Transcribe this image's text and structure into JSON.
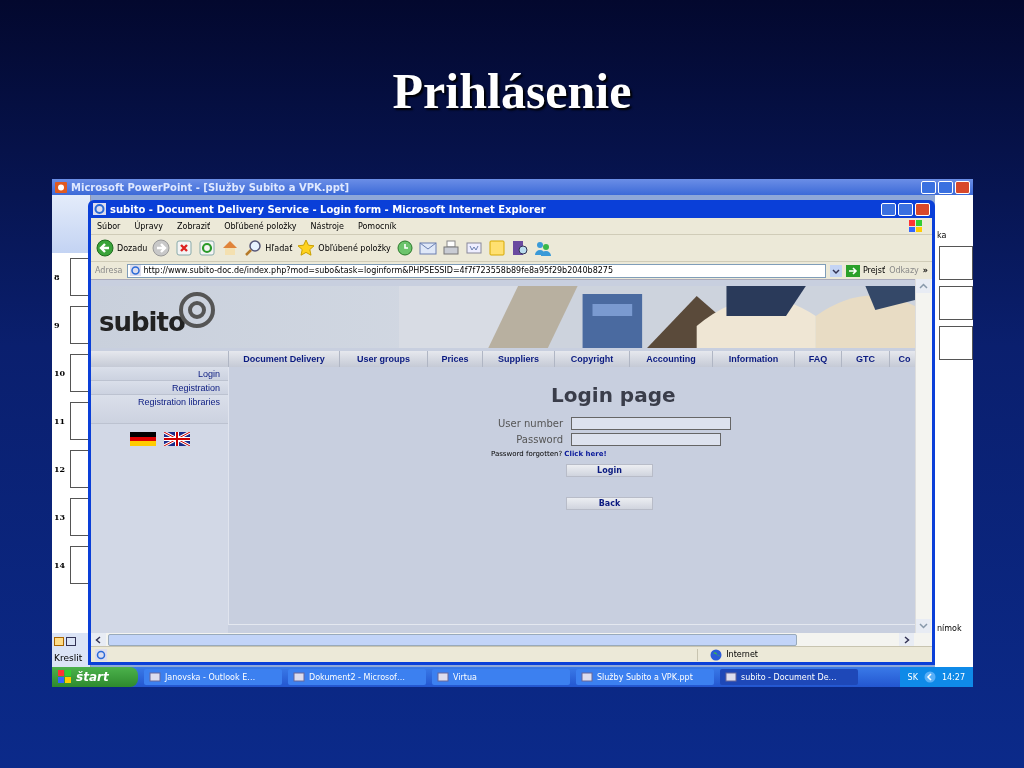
{
  "slide_title": "Prihlásenie",
  "powerpoint": {
    "title": "Microsoft PowerPoint - [Služby Subito a VPK.ppt]",
    "slide_numbers": [
      "8",
      "9",
      "10",
      "11",
      "12",
      "13",
      "14"
    ],
    "right_pane_texts": [
      "ka",
      "nímok"
    ],
    "drawing_toolbar": "Kreslit"
  },
  "browser": {
    "title": "subito - Document Delivery Service - Login form - Microsoft Internet Explorer",
    "menu": [
      "Súbor",
      "Úpravy",
      "Zobraziť",
      "Obľúbené položky",
      "Nástroje",
      "Pomocník"
    ],
    "toolbar": [
      {
        "kind": "back",
        "label": "Dozadu"
      },
      {
        "kind": "forward"
      },
      {
        "kind": "stop"
      },
      {
        "kind": "refresh"
      },
      {
        "kind": "home"
      },
      {
        "kind": "search",
        "label": "Hľadať"
      },
      {
        "kind": "favorites",
        "label": "Obľúbené položky"
      },
      {
        "kind": "history"
      },
      {
        "kind": "mail"
      },
      {
        "kind": "print"
      },
      {
        "kind": "edit"
      },
      {
        "kind": "note"
      },
      {
        "kind": "research"
      },
      {
        "kind": "messenger"
      }
    ],
    "address": {
      "label": "Adresa",
      "url": "http://www.subito-doc.de/index.php?mod=subo&task=loginform&PHPSESSID=4f7f723558b89fe8a95f29b2040b8275",
      "go": "Prejsť",
      "links": "Odkazy",
      "more": "»"
    },
    "page": {
      "logo": "subito",
      "nav": [
        "Document Delivery",
        "User groups",
        "Prices",
        "Suppliers",
        "Copyright",
        "Accounting",
        "Information",
        "FAQ",
        "GTC",
        "Co"
      ],
      "sidebar": [
        "Login",
        "Registration",
        "Registration libraries"
      ],
      "flags": [
        {
          "kind": "de"
        },
        {
          "kind": "gb"
        }
      ],
      "heading": "Login page",
      "fields": [
        {
          "label": "User number"
        },
        {
          "label": "Password"
        }
      ],
      "forgot_text": "Password forgotten?",
      "forgot_link": "Click here!",
      "buttons": [
        "Login",
        "Back"
      ]
    },
    "status": "Internet"
  },
  "taskbar": {
    "start": "štart",
    "tasks": [
      {
        "label": "Janovska - Outlook E…",
        "selected": false
      },
      {
        "label": "Dokument2 - Microsof…",
        "selected": false
      },
      {
        "label": "Virtua",
        "selected": false
      },
      {
        "label": "Služby Subito a VPK.ppt",
        "selected": false
      },
      {
        "label": "subito - Document De…",
        "selected": true
      }
    ],
    "language": "SK",
    "clock": "14:27"
  }
}
